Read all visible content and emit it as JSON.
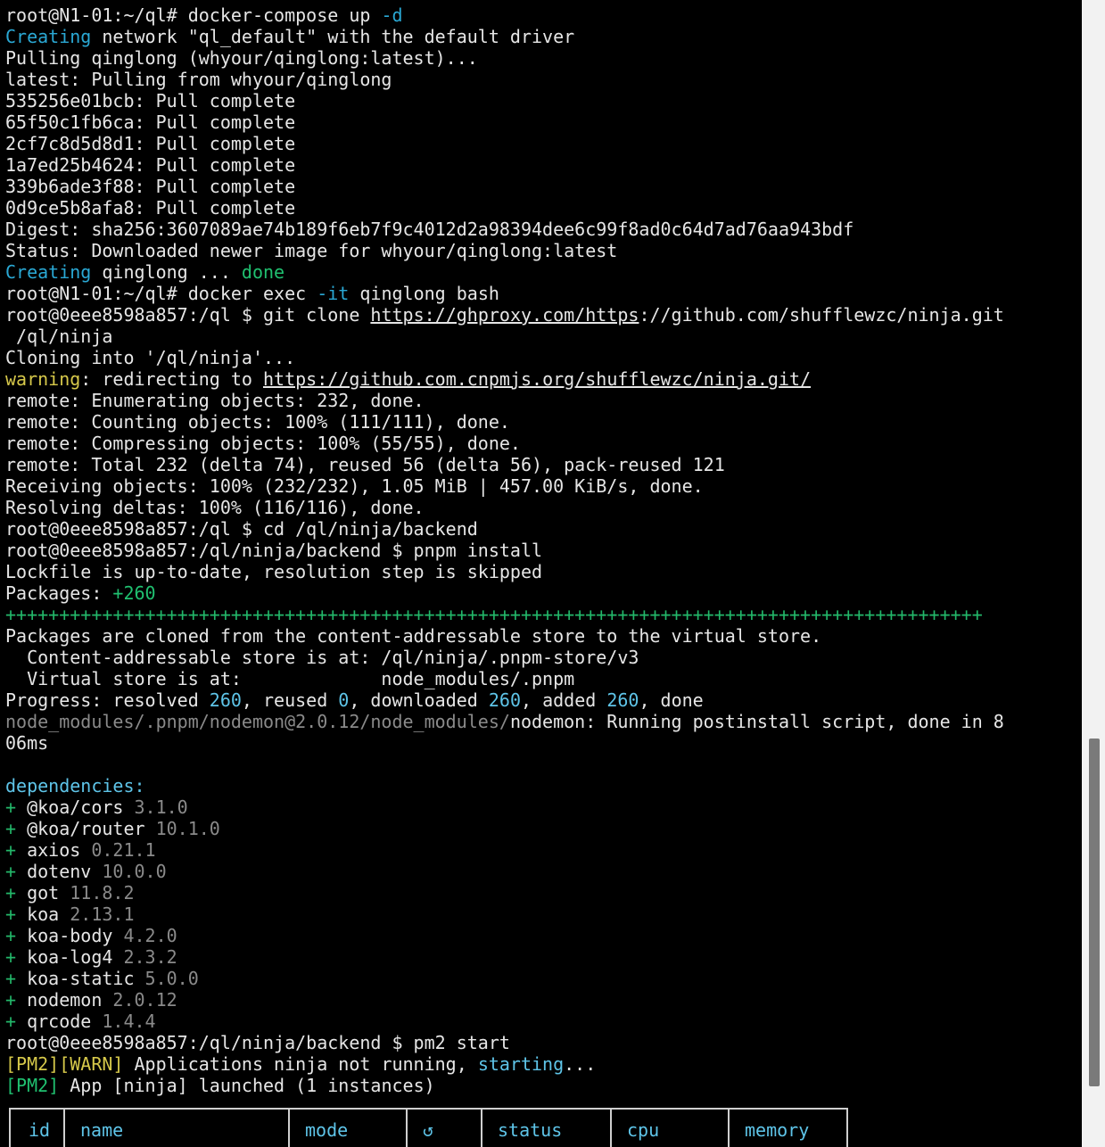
{
  "terminal": {
    "lines": [
      [
        {
          "t": "root@N1-01:~/ql# docker-compose up "
        },
        {
          "t": "-d",
          "c": "cyan"
        }
      ],
      [
        {
          "t": "Creating",
          "c": "cyan"
        },
        {
          "t": " network \"ql_default\" with the default driver"
        }
      ],
      [
        {
          "t": "Pulling qinglong (whyour/qinglong:latest)..."
        }
      ],
      [
        {
          "t": "latest: Pulling from whyour/qinglong"
        }
      ],
      [
        {
          "t": "535256e01bcb: Pull complete"
        }
      ],
      [
        {
          "t": "65f50c1fb6ca: Pull complete"
        }
      ],
      [
        {
          "t": "2cf7c8d5d8d1: Pull complete"
        }
      ],
      [
        {
          "t": "1a7ed25b4624: Pull complete"
        }
      ],
      [
        {
          "t": "339b6ade3f88: Pull complete"
        }
      ],
      [
        {
          "t": "0d9ce5b8afa8: Pull complete"
        }
      ],
      [
        {
          "t": "Digest: sha256:3607089ae74b189f6eb7f9c4012d2a98394dee6c99f8ad0c64d7ad76aa943bdf"
        }
      ],
      [
        {
          "t": "Status: Downloaded newer image for whyour/qinglong:latest"
        }
      ],
      [
        {
          "t": "Creating",
          "c": "cyan"
        },
        {
          "t": " qinglong ... "
        },
        {
          "t": "done",
          "c": "green"
        }
      ],
      [
        {
          "t": "root@N1-01:~/ql# docker exec "
        },
        {
          "t": "-it",
          "c": "cyan"
        },
        {
          "t": " qinglong bash"
        }
      ],
      [
        {
          "t": "root@0eee8598a857:/ql $ git clone "
        },
        {
          "t": "https://ghproxy.com/https",
          "u": true
        },
        {
          "t": "://github.com/shufflewzc/ninja.git"
        }
      ],
      [
        {
          "t": " /ql/ninja"
        }
      ],
      [
        {
          "t": "Cloning into '/ql/ninja'..."
        }
      ],
      [
        {
          "t": "warning",
          "c": "yellow"
        },
        {
          "t": ": redirecting to "
        },
        {
          "t": "https://github.com.cnpmjs.org/shufflewzc/ninja.git/",
          "u": true
        }
      ],
      [
        {
          "t": "remote: Enumerating objects: 232, done."
        }
      ],
      [
        {
          "t": "remote: Counting objects: 100% (111/111), done."
        }
      ],
      [
        {
          "t": "remote: Compressing objects: 100% (55/55), done."
        }
      ],
      [
        {
          "t": "remote: Total 232 (delta 74), reused 56 (delta 56), pack-reused 121"
        }
      ],
      [
        {
          "t": "Receiving objects: 100% (232/232), 1.05 MiB | 457.00 KiB/s, done."
        }
      ],
      [
        {
          "t": "Resolving deltas: 100% (116/116), done."
        }
      ],
      [
        {
          "t": "root@0eee8598a857:/ql $ cd /ql/ninja/backend"
        }
      ],
      [
        {
          "t": "root@0eee8598a857:/ql/ninja/backend $ pnpm install"
        }
      ],
      [
        {
          "t": "Lockfile is up-to-date, resolution step is skipped"
        }
      ],
      [
        {
          "t": "Packages: "
        },
        {
          "t": "+260",
          "c": "green"
        }
      ],
      [
        {
          "t": "+++++++++++++++++++++++++++++++++++++++++++++++++++++++++++++++++++++++++++++++++++++++++++",
          "c": "greenplus"
        }
      ],
      [
        {
          "t": "Packages are cloned from the content-addressable store to the virtual store."
        }
      ],
      [
        {
          "t": "  Content-addressable store is at: /ql/ninja/.pnpm-store/v3"
        }
      ],
      [
        {
          "t": "  Virtual store is at:             node_modules/.pnpm"
        }
      ],
      [
        {
          "t": "Progress: resolved "
        },
        {
          "t": "260",
          "c": "ltblue"
        },
        {
          "t": ", reused "
        },
        {
          "t": "0",
          "c": "ltblue"
        },
        {
          "t": ", downloaded "
        },
        {
          "t": "260",
          "c": "ltblue"
        },
        {
          "t": ", added "
        },
        {
          "t": "260",
          "c": "ltblue"
        },
        {
          "t": ", done"
        }
      ],
      [
        {
          "t": "node_modules/.pnpm/nodemon@2.0.12/node_modules/",
          "c": "gray"
        },
        {
          "t": "nodemon: Running postinstall script, done in 8"
        }
      ],
      [
        {
          "t": "06ms"
        }
      ],
      [
        {
          "t": ""
        }
      ],
      [
        {
          "t": "dependencies:",
          "c": "ltblue"
        }
      ],
      [
        {
          "t": "+ ",
          "c": "greenplus"
        },
        {
          "t": "@koa/cors "
        },
        {
          "t": "3.1.0",
          "c": "gray"
        }
      ],
      [
        {
          "t": "+ ",
          "c": "greenplus"
        },
        {
          "t": "@koa/router "
        },
        {
          "t": "10.1.0",
          "c": "gray"
        }
      ],
      [
        {
          "t": "+ ",
          "c": "greenplus"
        },
        {
          "t": "axios "
        },
        {
          "t": "0.21.1",
          "c": "gray"
        }
      ],
      [
        {
          "t": "+ ",
          "c": "greenplus"
        },
        {
          "t": "dotenv "
        },
        {
          "t": "10.0.0",
          "c": "gray"
        }
      ],
      [
        {
          "t": "+ ",
          "c": "greenplus"
        },
        {
          "t": "got "
        },
        {
          "t": "11.8.2",
          "c": "gray"
        }
      ],
      [
        {
          "t": "+ ",
          "c": "greenplus"
        },
        {
          "t": "koa "
        },
        {
          "t": "2.13.1",
          "c": "gray"
        }
      ],
      [
        {
          "t": "+ ",
          "c": "greenplus"
        },
        {
          "t": "koa-body "
        },
        {
          "t": "4.2.0",
          "c": "gray"
        }
      ],
      [
        {
          "t": "+ ",
          "c": "greenplus"
        },
        {
          "t": "koa-log4 "
        },
        {
          "t": "2.3.2",
          "c": "gray"
        }
      ],
      [
        {
          "t": "+ ",
          "c": "greenplus"
        },
        {
          "t": "koa-static "
        },
        {
          "t": "5.0.0",
          "c": "gray"
        }
      ],
      [
        {
          "t": "+ ",
          "c": "greenplus"
        },
        {
          "t": "nodemon "
        },
        {
          "t": "2.0.12",
          "c": "gray"
        }
      ],
      [
        {
          "t": "+ ",
          "c": "greenplus"
        },
        {
          "t": "qrcode "
        },
        {
          "t": "1.4.4",
          "c": "gray"
        }
      ],
      [
        {
          "t": "root@0eee8598a857:/ql/ninja/backend $ pm2 start"
        }
      ],
      [
        {
          "t": "[PM2][WARN]",
          "c": "yellow"
        },
        {
          "t": " Applications ninja not running, "
        },
        {
          "t": "starting",
          "c": "ltblue"
        },
        {
          "t": "..."
        }
      ],
      [
        {
          "t": "[PM2]",
          "c": "green"
        },
        {
          "t": " App [ninja] launched (1 instances)"
        }
      ]
    ]
  },
  "pm2_table": {
    "headers": [
      "id",
      "name",
      "mode",
      "↺",
      "status",
      "cpu",
      "memory"
    ]
  },
  "colors": {
    "background": "#000000",
    "foreground": "#e6e6e6",
    "cyan": "#2aa8d4",
    "green": "#20c070",
    "yellow": "#d6c84a",
    "gray": "#8a8a8a",
    "light_blue": "#5ec4e8"
  }
}
